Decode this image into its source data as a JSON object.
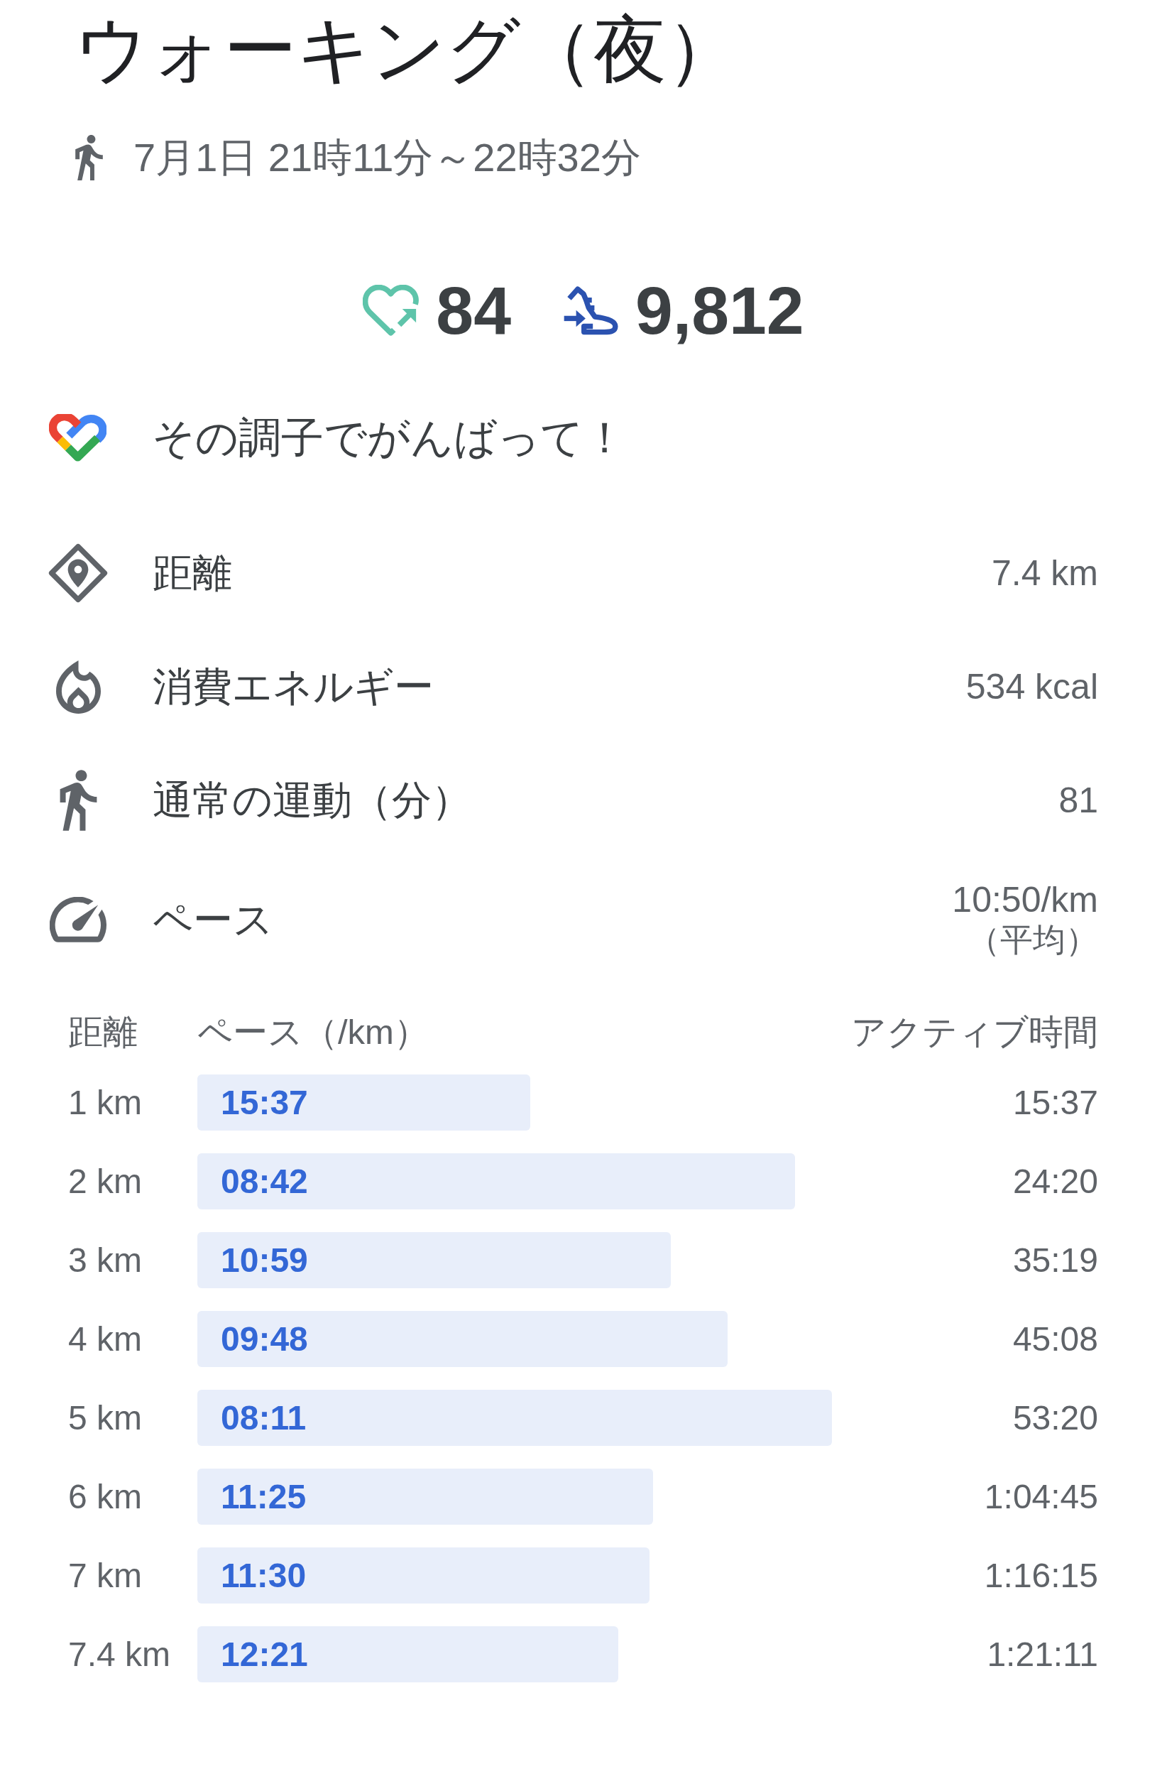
{
  "header": {
    "title": "ウォーキング（夜）",
    "time": "7月1日 21時11分～22時32分"
  },
  "summary": {
    "heart_points": "84",
    "steps": "9,812"
  },
  "message": "その調子でがんばって！",
  "metrics": [
    {
      "kind": "distance",
      "label": "距離",
      "value": "7.4 km"
    },
    {
      "kind": "energy",
      "label": "消費エネルギー",
      "value": "534 kcal"
    },
    {
      "kind": "move_minutes",
      "label": "通常の運動（分）",
      "value": "81"
    },
    {
      "kind": "pace",
      "label": "ペース",
      "value": "10:50/km",
      "note": "（平均）"
    }
  ],
  "splits": {
    "columns": [
      "距離",
      "ペース（/km）",
      "アクティブ時間"
    ],
    "rows": [
      {
        "distance": "1 km",
        "pace": "15:37",
        "active_time": "15:37"
      },
      {
        "distance": "2 km",
        "pace": "08:42",
        "active_time": "24:20"
      },
      {
        "distance": "3 km",
        "pace": "10:59",
        "active_time": "35:19"
      },
      {
        "distance": "4 km",
        "pace": "09:48",
        "active_time": "45:08"
      },
      {
        "distance": "5 km",
        "pace": "08:11",
        "active_time": "53:20"
      },
      {
        "distance": "6 km",
        "pace": "11:25",
        "active_time": "1:04:45"
      },
      {
        "distance": "7 km",
        "pace": "11:30",
        "active_time": "1:16:15"
      },
      {
        "distance": "7.4 km",
        "pace": "12:21",
        "active_time": "1:21:11"
      }
    ]
  }
}
